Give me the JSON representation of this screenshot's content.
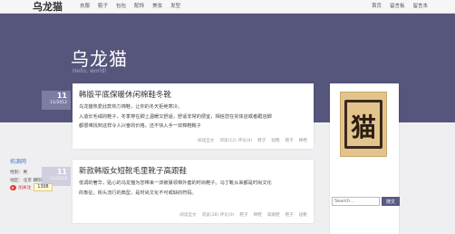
{
  "site": {
    "logo": "乌龙猫"
  },
  "nav": {
    "items": [
      "衣服",
      "鞋子",
      "包包",
      "配饰",
      "美妆",
      "发型"
    ],
    "right": [
      "首页",
      "留言板",
      "留言本"
    ]
  },
  "hero": {
    "title": "乌龙猫",
    "subtitle": "Hello, world!"
  },
  "posts": [
    {
      "day": "11",
      "ym": "11/2012",
      "title": "韩版平底保暖休闲棉鞋冬靴",
      "body": [
        "乌龙猫热爱此款热力棉鞋，让你的冬天拒绝寒冷。",
        "入造长毛绒的鞋子，冬季穿在脚上温暖又舒适，舒适非常的便宜，相信您在实体店或者跟店脚",
        "都很难找到这样令人兴奋的价格，还不快入手一双棉鞋靴子"
      ],
      "meta": [
        "阅读全文",
        "浏览(12) 评论(0)",
        "鞋子",
        "短靴",
        "鞋子",
        "棉鞋"
      ]
    },
    {
      "day": "11",
      "ym": "11/2012",
      "title": "新款韩版女短靴毛里靴子高跟鞋",
      "body": [
        "低调的奢华，贴心的乌龙猫为您带来一双被暴领棉外套的时尚鞋子。马丁靴从来都是时尚文化",
        "的象征。街头流行的典型，是时尚文化不可或缺的符码。"
      ],
      "meta": [
        "阅读全文",
        "浏览(28) 评论(0)",
        "鞋子",
        "棉鞋",
        "高跟鞋",
        "鞋子",
        "短靴"
      ]
    }
  ],
  "sidebar": {
    "avatar_char": "猫",
    "name": "拓源网",
    "sex": "性别：男",
    "location": "地区：北京 朝阳",
    "follow_label": "加关注",
    "follow_count": "1308"
  },
  "search": {
    "placeholder": "Search...",
    "button": "搜文"
  }
}
